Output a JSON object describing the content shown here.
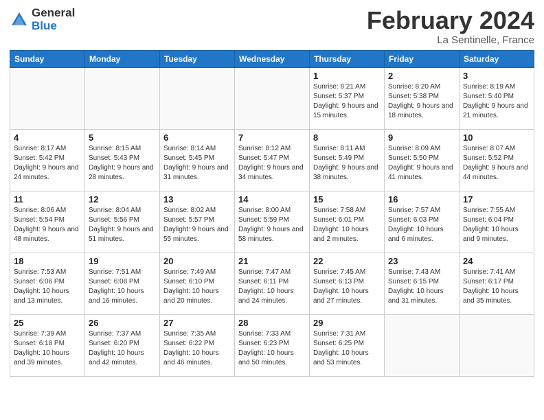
{
  "logo": {
    "general": "General",
    "blue": "Blue"
  },
  "title": {
    "month": "February 2024",
    "location": "La Sentinelle, France"
  },
  "weekdays": [
    "Sunday",
    "Monday",
    "Tuesday",
    "Wednesday",
    "Thursday",
    "Friday",
    "Saturday"
  ],
  "weeks": [
    [
      {
        "day": "",
        "info": ""
      },
      {
        "day": "",
        "info": ""
      },
      {
        "day": "",
        "info": ""
      },
      {
        "day": "",
        "info": ""
      },
      {
        "day": "1",
        "info": "Sunrise: 8:21 AM\nSunset: 5:37 PM\nDaylight: 9 hours and 15 minutes."
      },
      {
        "day": "2",
        "info": "Sunrise: 8:20 AM\nSunset: 5:38 PM\nDaylight: 9 hours and 18 minutes."
      },
      {
        "day": "3",
        "info": "Sunrise: 8:19 AM\nSunset: 5:40 PM\nDaylight: 9 hours and 21 minutes."
      }
    ],
    [
      {
        "day": "4",
        "info": "Sunrise: 8:17 AM\nSunset: 5:42 PM\nDaylight: 9 hours and 24 minutes."
      },
      {
        "day": "5",
        "info": "Sunrise: 8:15 AM\nSunset: 5:43 PM\nDaylight: 9 hours and 28 minutes."
      },
      {
        "day": "6",
        "info": "Sunrise: 8:14 AM\nSunset: 5:45 PM\nDaylight: 9 hours and 31 minutes."
      },
      {
        "day": "7",
        "info": "Sunrise: 8:12 AM\nSunset: 5:47 PM\nDaylight: 9 hours and 34 minutes."
      },
      {
        "day": "8",
        "info": "Sunrise: 8:11 AM\nSunset: 5:49 PM\nDaylight: 9 hours and 38 minutes."
      },
      {
        "day": "9",
        "info": "Sunrise: 8:09 AM\nSunset: 5:50 PM\nDaylight: 9 hours and 41 minutes."
      },
      {
        "day": "10",
        "info": "Sunrise: 8:07 AM\nSunset: 5:52 PM\nDaylight: 9 hours and 44 minutes."
      }
    ],
    [
      {
        "day": "11",
        "info": "Sunrise: 8:06 AM\nSunset: 5:54 PM\nDaylight: 9 hours and 48 minutes."
      },
      {
        "day": "12",
        "info": "Sunrise: 8:04 AM\nSunset: 5:56 PM\nDaylight: 9 hours and 51 minutes."
      },
      {
        "day": "13",
        "info": "Sunrise: 8:02 AM\nSunset: 5:57 PM\nDaylight: 9 hours and 55 minutes."
      },
      {
        "day": "14",
        "info": "Sunrise: 8:00 AM\nSunset: 5:59 PM\nDaylight: 9 hours and 58 minutes."
      },
      {
        "day": "15",
        "info": "Sunrise: 7:58 AM\nSunset: 6:01 PM\nDaylight: 10 hours and 2 minutes."
      },
      {
        "day": "16",
        "info": "Sunrise: 7:57 AM\nSunset: 6:03 PM\nDaylight: 10 hours and 6 minutes."
      },
      {
        "day": "17",
        "info": "Sunrise: 7:55 AM\nSunset: 6:04 PM\nDaylight: 10 hours and 9 minutes."
      }
    ],
    [
      {
        "day": "18",
        "info": "Sunrise: 7:53 AM\nSunset: 6:06 PM\nDaylight: 10 hours and 13 minutes."
      },
      {
        "day": "19",
        "info": "Sunrise: 7:51 AM\nSunset: 6:08 PM\nDaylight: 10 hours and 16 minutes."
      },
      {
        "day": "20",
        "info": "Sunrise: 7:49 AM\nSunset: 6:10 PM\nDaylight: 10 hours and 20 minutes."
      },
      {
        "day": "21",
        "info": "Sunrise: 7:47 AM\nSunset: 6:11 PM\nDaylight: 10 hours and 24 minutes."
      },
      {
        "day": "22",
        "info": "Sunrise: 7:45 AM\nSunset: 6:13 PM\nDaylight: 10 hours and 27 minutes."
      },
      {
        "day": "23",
        "info": "Sunrise: 7:43 AM\nSunset: 6:15 PM\nDaylight: 10 hours and 31 minutes."
      },
      {
        "day": "24",
        "info": "Sunrise: 7:41 AM\nSunset: 6:17 PM\nDaylight: 10 hours and 35 minutes."
      }
    ],
    [
      {
        "day": "25",
        "info": "Sunrise: 7:39 AM\nSunset: 6:18 PM\nDaylight: 10 hours and 39 minutes."
      },
      {
        "day": "26",
        "info": "Sunrise: 7:37 AM\nSunset: 6:20 PM\nDaylight: 10 hours and 42 minutes."
      },
      {
        "day": "27",
        "info": "Sunrise: 7:35 AM\nSunset: 6:22 PM\nDaylight: 10 hours and 46 minutes."
      },
      {
        "day": "28",
        "info": "Sunrise: 7:33 AM\nSunset: 6:23 PM\nDaylight: 10 hours and 50 minutes."
      },
      {
        "day": "29",
        "info": "Sunrise: 7:31 AM\nSunset: 6:25 PM\nDaylight: 10 hours and 53 minutes."
      },
      {
        "day": "",
        "info": ""
      },
      {
        "day": "",
        "info": ""
      }
    ]
  ]
}
